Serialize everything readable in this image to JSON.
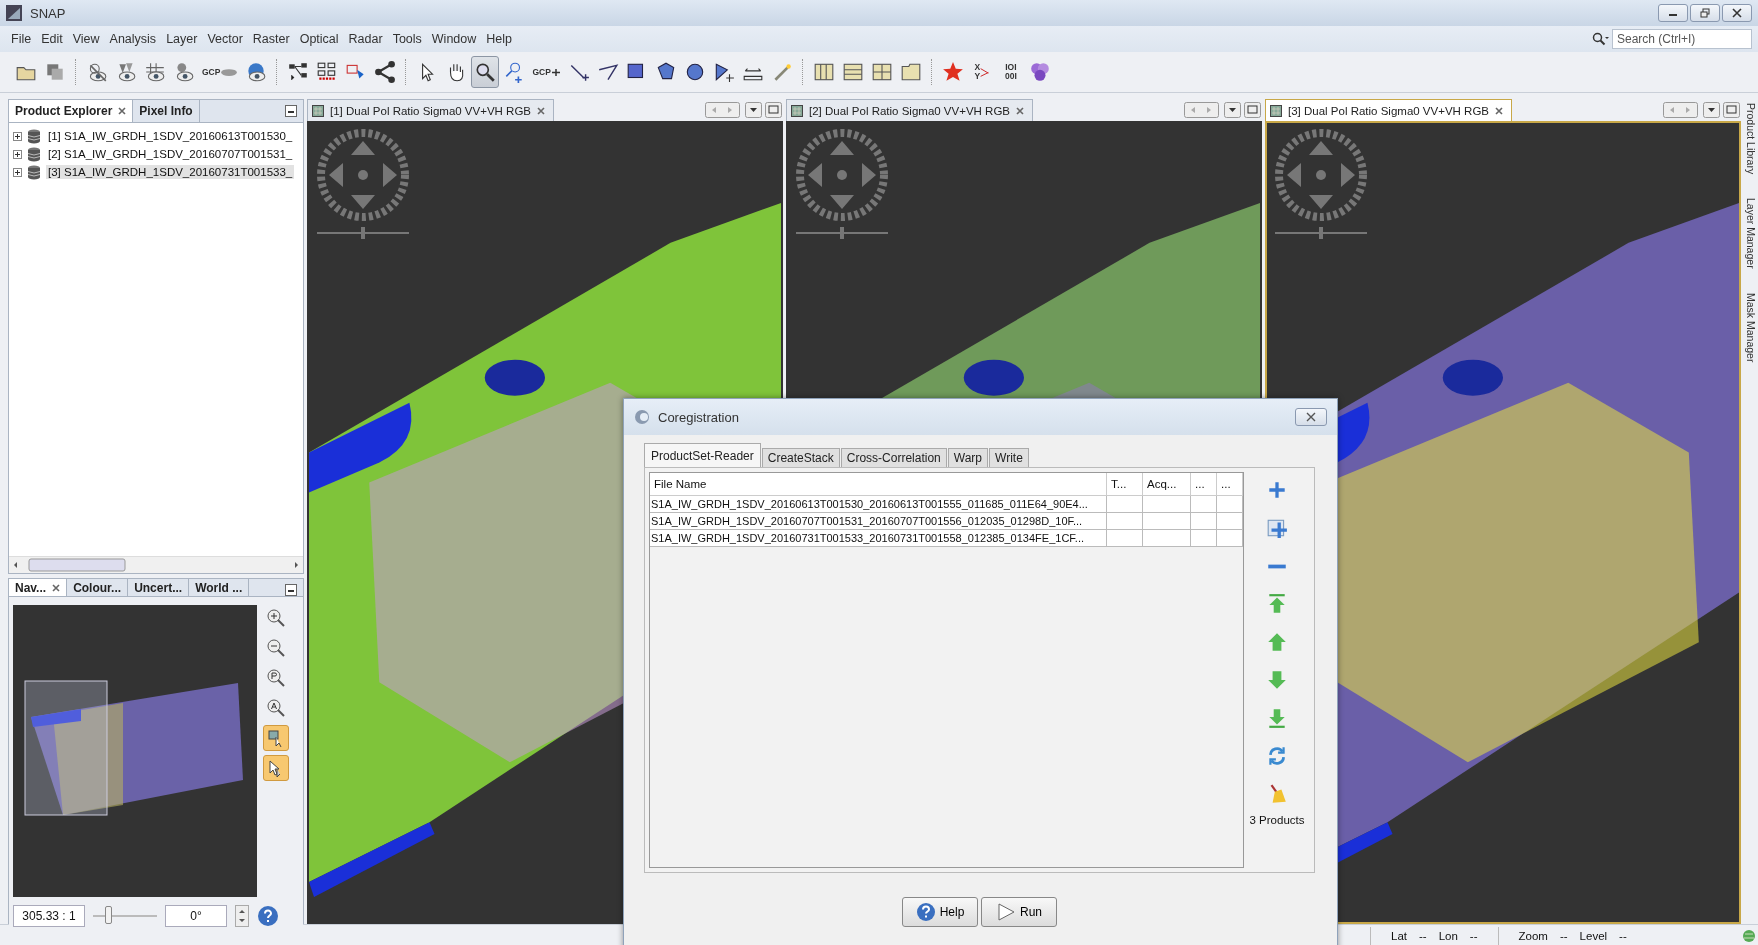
{
  "window": {
    "title": "SNAP"
  },
  "menu": [
    "File",
    "Edit",
    "View",
    "Analysis",
    "Layer",
    "Vector",
    "Raster",
    "Optical",
    "Radar",
    "Tools",
    "Window",
    "Help"
  ],
  "search": {
    "placeholder": "Search (Ctrl+I)"
  },
  "toolbar": [
    {
      "kind": "open",
      "selected": false
    },
    {
      "kind": "session",
      "selected": false
    },
    {
      "kind": "separator"
    },
    {
      "kind": "eyeoff",
      "selected": false
    },
    {
      "kind": "pins",
      "selected": false
    },
    {
      "kind": "grid",
      "selected": false
    },
    {
      "kind": "pin",
      "selected": false
    },
    {
      "kind": "gcp",
      "lines": [
        "GCP"
      ],
      "selected": false
    },
    {
      "kind": "world",
      "selected": false
    },
    {
      "kind": "separator"
    },
    {
      "kind": "graph",
      "selected": false
    },
    {
      "kind": "batch",
      "selected": false
    },
    {
      "kind": "flow",
      "selected": false
    },
    {
      "kind": "share",
      "selected": false
    },
    {
      "kind": "separator"
    },
    {
      "kind": "pointer",
      "selected": false
    },
    {
      "kind": "hand",
      "selected": false
    },
    {
      "kind": "zoom",
      "selected": true
    },
    {
      "kind": "pinadd",
      "selected": false
    },
    {
      "kind": "gcpadd",
      "lines": [
        "GCP"
      ],
      "selected": false
    },
    {
      "kind": "line",
      "selected": false
    },
    {
      "kind": "polyline",
      "selected": false
    },
    {
      "kind": "rect",
      "selected": false
    },
    {
      "kind": "polygon",
      "selected": false
    },
    {
      "kind": "ellipse",
      "selected": false
    },
    {
      "kind": "insert",
      "selected": false
    },
    {
      "kind": "measure",
      "selected": false
    },
    {
      "kind": "wand",
      "selected": false
    },
    {
      "kind": "separator"
    },
    {
      "kind": "tilev",
      "selected": false
    },
    {
      "kind": "tileh",
      "selected": false
    },
    {
      "kind": "tilegrid",
      "selected": false
    },
    {
      "kind": "tilenone",
      "selected": false
    },
    {
      "kind": "separator"
    },
    {
      "kind": "star",
      "selected": false
    },
    {
      "kind": "xy",
      "lines": [
        "X",
        "Y"
      ],
      "selected": false
    },
    {
      "kind": "binary",
      "lines": [
        "IOI",
        "00I"
      ],
      "selected": false
    },
    {
      "kind": "hex",
      "selected": false
    }
  ],
  "product_explorer": {
    "tabs": [
      {
        "label": "Product Explorer",
        "selected": true
      },
      {
        "label": "Pixel Info",
        "selected": false
      }
    ],
    "items": [
      {
        "label": "[1] S1A_IW_GRDH_1SDV_20160613T001530_",
        "expanded": false,
        "selected": false
      },
      {
        "label": "[2] S1A_IW_GRDH_1SDV_20160707T001531_",
        "expanded": false,
        "selected": false
      },
      {
        "label": "[3] S1A_IW_GRDH_1SDV_20160731T001533_",
        "expanded": false,
        "selected": true
      }
    ]
  },
  "navigation": {
    "tabs": [
      {
        "label": "Nav...",
        "selected": true
      },
      {
        "label": "Colour...",
        "selected": false
      },
      {
        "label": "Uncert...",
        "selected": false
      },
      {
        "label": "World ...",
        "selected": false
      }
    ],
    "tools": [
      {
        "kind": "zoomin",
        "selected": false
      },
      {
        "kind": "zoomout",
        "selected": false
      },
      {
        "kind": "zoompixel",
        "selected": false
      },
      {
        "kind": "zoomall",
        "selected": false
      },
      {
        "kind": "syncviews",
        "selected": true
      },
      {
        "kind": "synccursor",
        "selected": true
      }
    ],
    "scale": "305.33 : 1",
    "slider": {
      "level": 0.25
    },
    "angle": "0°"
  },
  "views": [
    {
      "title": "[1] Dual Pol Ratio Sigma0 VV+VH RGB",
      "selected": false,
      "kind": "green"
    },
    {
      "title": "[2] Dual Pol Ratio Sigma0 VV+VH RGB",
      "selected": false,
      "kind": "mixed"
    },
    {
      "title": "[3] Dual Pol Ratio Sigma0 VV+VH RGB",
      "selected": true,
      "kind": "violet"
    }
  ],
  "side_tabs": [
    "Product Library",
    "Layer Manager",
    "Mask Manager"
  ],
  "dialog": {
    "title": "Coregistration",
    "tabs": [
      {
        "label": "ProductSet-Reader",
        "selected": true
      },
      {
        "label": "CreateStack",
        "selected": false
      },
      {
        "label": "Cross-Correlation",
        "selected": false
      },
      {
        "label": "Warp",
        "selected": false
      },
      {
        "label": "Write",
        "selected": false
      }
    ],
    "columns": [
      "File Name",
      "T...",
      "Acq...",
      "...",
      "..."
    ],
    "rows": [
      [
        "S1A_IW_GRDH_1SDV_20160613T001530_20160613T001555_011685_011E64_90E4...",
        "",
        "",
        "",
        ""
      ],
      [
        "S1A_IW_GRDH_1SDV_20160707T001531_20160707T001556_012035_01298D_10F...",
        "",
        "",
        "",
        ""
      ],
      [
        "S1A_IW_GRDH_1SDV_20160731T001533_20160731T001558_012385_0134FE_1CF...",
        "",
        "",
        "",
        ""
      ]
    ],
    "side_buttons": [
      {
        "kind": "add"
      },
      {
        "kind": "addopen"
      },
      {
        "kind": "remove"
      },
      {
        "kind": "top"
      },
      {
        "kind": "up"
      },
      {
        "kind": "down"
      },
      {
        "kind": "bottom"
      },
      {
        "kind": "refresh"
      },
      {
        "kind": "clear"
      }
    ],
    "count": "3 Products",
    "buttons": [
      {
        "kind": "help",
        "label": "Help"
      },
      {
        "kind": "run",
        "label": "Run"
      }
    ]
  },
  "status_bar": {
    "position": [
      {
        "label": "Lat",
        "value": "--"
      },
      {
        "label": "Lon",
        "value": "--"
      }
    ],
    "zoom": [
      {
        "label": "Zoom",
        "value": "--"
      },
      {
        "label": "Level",
        "value": "--"
      }
    ]
  }
}
